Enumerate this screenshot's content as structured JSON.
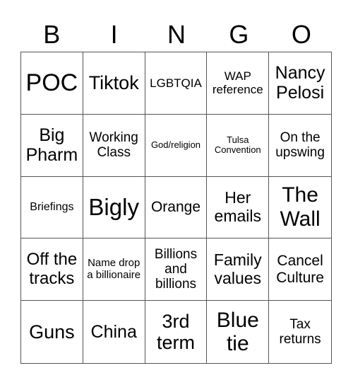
{
  "header": {
    "letters": [
      "B",
      "I",
      "N",
      "G",
      "O"
    ]
  },
  "cells": [
    {
      "text": "POC",
      "size": 34
    },
    {
      "text": "Tiktok",
      "size": 27
    },
    {
      "text": "LGBTQIA",
      "size": 17
    },
    {
      "text": "WAP reference",
      "size": 17
    },
    {
      "text": "Nancy Pelosi",
      "size": 25
    },
    {
      "text": "Big Pharm",
      "size": 25
    },
    {
      "text": "Working Class",
      "size": 19
    },
    {
      "text": "God/religion",
      "size": 13
    },
    {
      "text": "Tulsa Convention",
      "size": 13
    },
    {
      "text": "On the upswing",
      "size": 19
    },
    {
      "text": "Briefings",
      "size": 16
    },
    {
      "text": "Bigly",
      "size": 33
    },
    {
      "text": "Orange",
      "size": 21
    },
    {
      "text": "Her emails",
      "size": 23
    },
    {
      "text": "The Wall",
      "size": 30
    },
    {
      "text": "Off the tracks",
      "size": 24
    },
    {
      "text": "Name drop a billionaire",
      "size": 15
    },
    {
      "text": "Billions and billions",
      "size": 19
    },
    {
      "text": "Family values",
      "size": 23
    },
    {
      "text": "Cancel Culture",
      "size": 21
    },
    {
      "text": "Guns",
      "size": 27
    },
    {
      "text": "China",
      "size": 25
    },
    {
      "text": "3rd term",
      "size": 27
    },
    {
      "text": "Blue tie",
      "size": 30
    },
    {
      "text": "Tax returns",
      "size": 19
    }
  ]
}
